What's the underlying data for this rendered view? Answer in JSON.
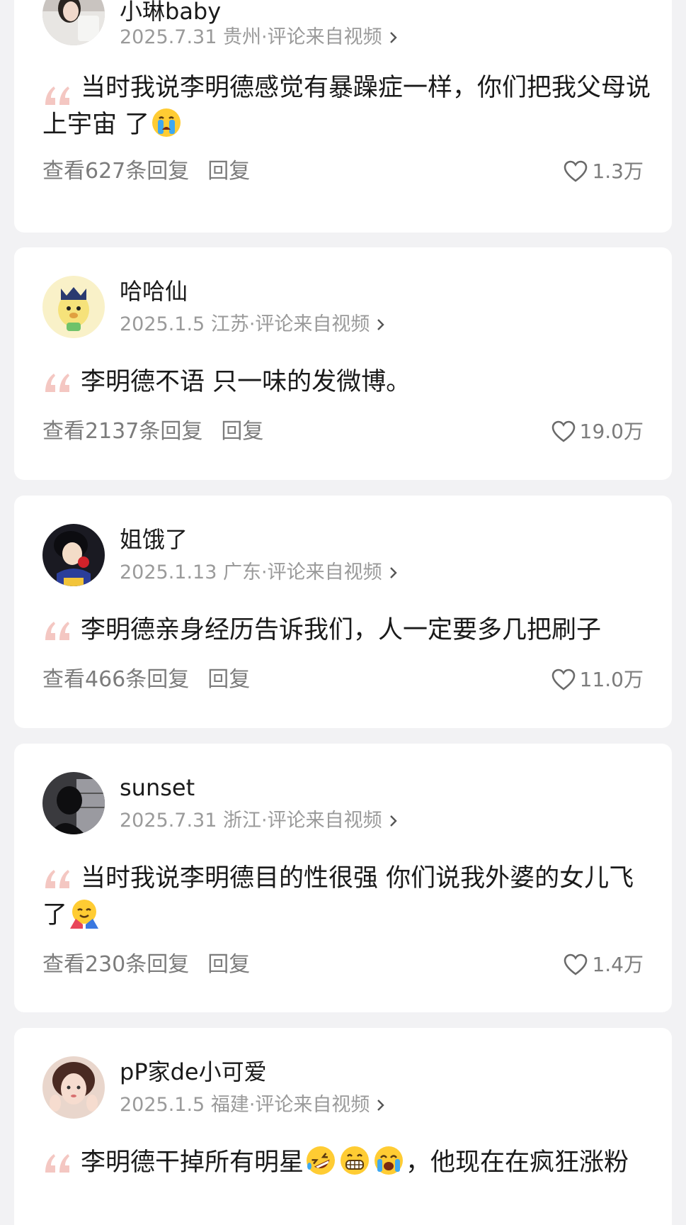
{
  "comments": [
    {
      "username": "小琳baby",
      "date": "2025.7.31",
      "location": "贵州",
      "source": "·评论来自视频",
      "text_before": "当时我说李明德感觉有暴躁症一样，你们把我父母说上宇宙 了",
      "emojis": [
        "crying-face-emoji"
      ],
      "text_after": "",
      "replies_label": "查看627条回复",
      "reply_label": "回复",
      "likes": "1.3万"
    },
    {
      "username": "哈哈仙",
      "date": "2025.1.5",
      "location": "江苏",
      "source": "·评论来自视频",
      "text_before": "李明德不语 只一味的发微博。",
      "emojis": [],
      "text_after": "",
      "replies_label": "查看2137条回复",
      "reply_label": "回复",
      "likes": "19.0万"
    },
    {
      "username": "姐饿了",
      "date": "2025.1.13",
      "location": "广东",
      "source": "·评论来自视频",
      "text_before": "李明德亲身经历告诉我们，人一定要多几把刷子",
      "emojis": [],
      "text_after": "",
      "replies_label": "查看466条回复",
      "reply_label": "回复",
      "likes": "11.0万"
    },
    {
      "username": "sunset",
      "date": "2025.7.31",
      "location": "浙江",
      "source": "·评论来自视频",
      "text_before": "当时我说李明德目的性很强 你们说我外婆的女儿飞了",
      "emojis": [
        "hugging-emoji"
      ],
      "text_after": "",
      "replies_label": "查看230条回复",
      "reply_label": "回复",
      "likes": "1.4万"
    },
    {
      "username": "pP家de小可爱",
      "date": "2025.1.5",
      "location": "福建",
      "source": "·评论来自视频",
      "text_before": "李明德干掉所有明星",
      "emojis": [
        "rofl-emoji",
        "grin-emoji",
        "sob-emoji"
      ],
      "text_after": "，他现在在疯狂涨粉",
      "replies_label": "",
      "reply_label": "",
      "likes": ""
    }
  ],
  "colors": {
    "background": "#f2f2f4",
    "card": "#ffffff",
    "quote": "#f4c7c2",
    "meta": "#9a9a9a"
  }
}
